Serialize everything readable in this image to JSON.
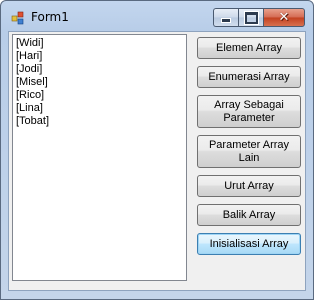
{
  "window": {
    "title": "Form1",
    "icon": "winforms-app-icon",
    "caption_buttons": [
      "minimize-icon",
      "maximize-icon",
      "close-icon"
    ],
    "close_glyph": "✕"
  },
  "listbox": {
    "items": [
      "[Widi]",
      "[Hari]",
      "[Jodi]",
      "[Misel]",
      "[Rico]",
      "[Lina]",
      "[Tobat]"
    ]
  },
  "buttons": {
    "elemen_array": "Elemen Array",
    "enumerasi_array": "Enumerasi Array",
    "array_sebagai_parameter": "Array Sebagai Parameter",
    "parameter_array_lain": "Parameter Array Lain",
    "urut_array": "Urut Array",
    "balik_array": "Balik Array",
    "inisialisasi_array": "Inisialisasi Array"
  },
  "focused_button": "inisialisasi_array"
}
